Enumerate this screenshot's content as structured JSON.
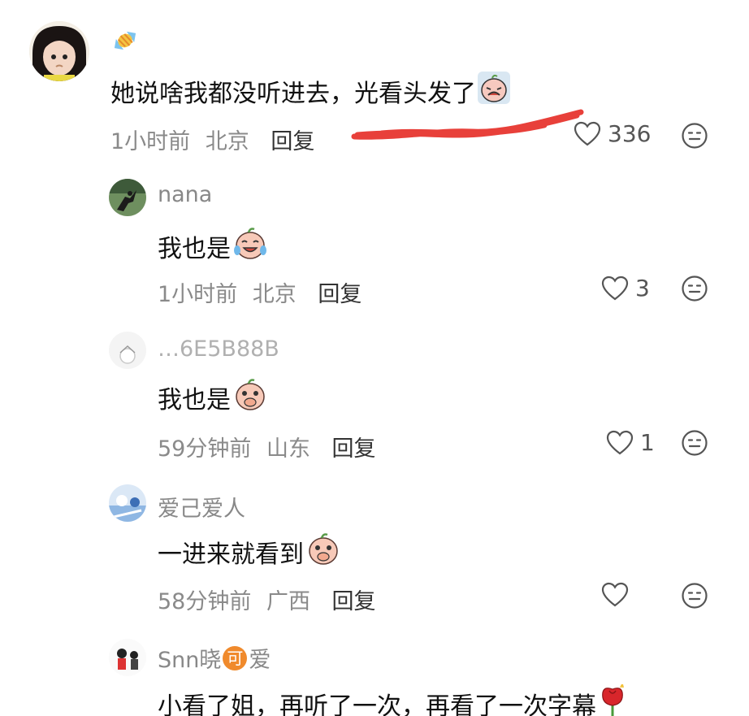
{
  "top": {
    "text": "她说啥我都没听进去，光看头发了",
    "time": "1小时前",
    "location": "北京",
    "reply": "回复",
    "likes": "336"
  },
  "replies": [
    {
      "name": "nana",
      "text": "我也是",
      "time": "1小时前",
      "location": "北京",
      "reply": "回复",
      "likes": "3"
    },
    {
      "name": "…6E5B88B",
      "text": "我也是",
      "time": "59分钟前",
      "location": "山东",
      "reply": "回复",
      "likes": "1"
    },
    {
      "name": "爱己爱人",
      "text": "一进来就看到",
      "time": "58分钟前",
      "location": "广西",
      "reply": "回复",
      "likes": ""
    },
    {
      "name_prefix": "Snn晓",
      "name_badge": "可",
      "name_suffix": "爱",
      "text": "小看了姐，再听了一次，再看了一次字幕"
    }
  ],
  "colors": {
    "meta": "#8a8a8a",
    "scribble": "#e8403a",
    "badge": "#f08a2c"
  }
}
